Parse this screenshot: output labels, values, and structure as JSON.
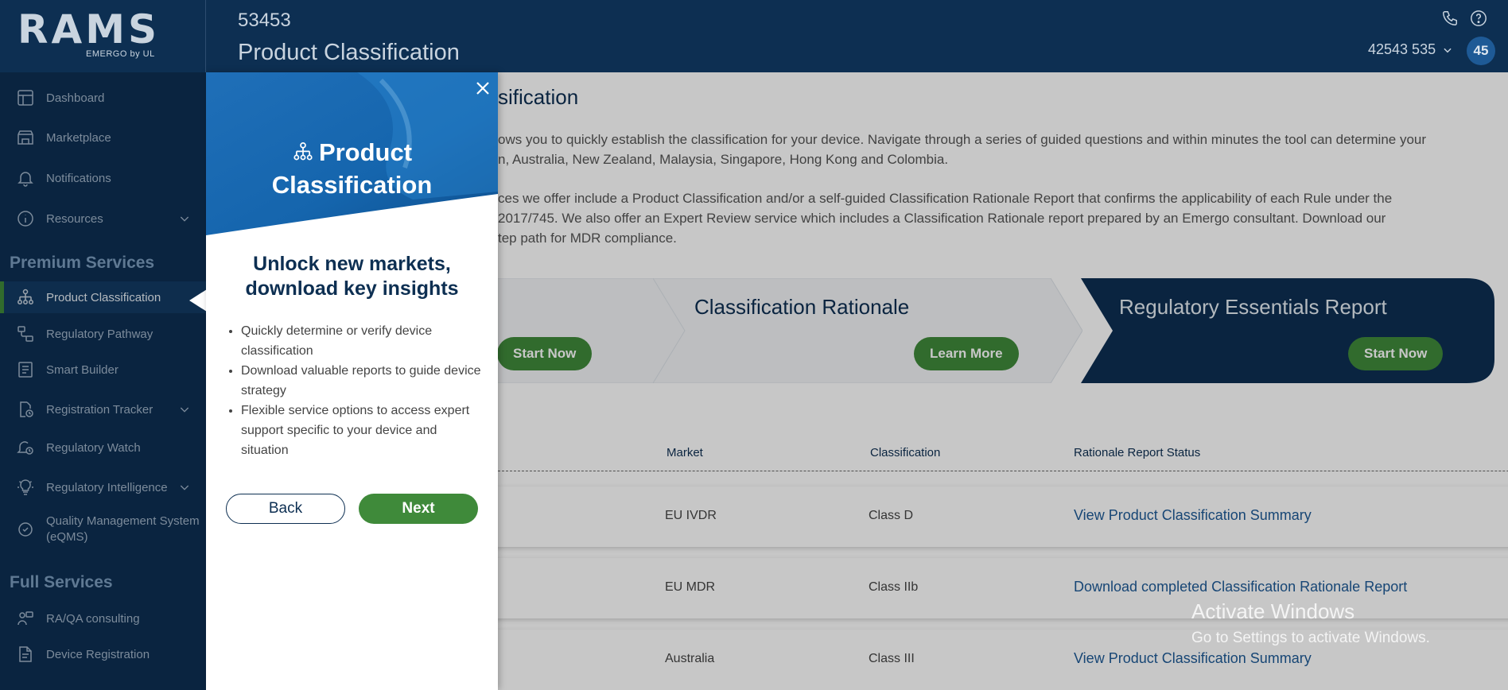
{
  "header": {
    "logo_text": "RAMS",
    "logo_sub": "EMERGO by UL",
    "record_id": "53453",
    "page_title": "Product Classification",
    "account_label": "42543 535",
    "avatar_text": "45"
  },
  "sidebar": {
    "top_items": [
      {
        "label": "Dashboard",
        "icon": "dashboard-icon"
      },
      {
        "label": "Marketplace",
        "icon": "store-icon"
      },
      {
        "label": "Notifications",
        "icon": "bell-icon"
      },
      {
        "label": "Resources",
        "icon": "info-icon"
      }
    ],
    "premium_heading": "Premium Services",
    "premium_items": [
      {
        "label": "Product Classification",
        "icon": "hierarchy-icon",
        "active": true
      },
      {
        "label": "Regulatory Pathway",
        "icon": "pathway-icon"
      },
      {
        "label": "Smart Builder",
        "icon": "document-icon"
      },
      {
        "label": "Registration Tracker",
        "icon": "tracker-icon"
      },
      {
        "label": "Regulatory Watch",
        "icon": "bell-clock-icon"
      },
      {
        "label": "Regulatory Intelligence",
        "icon": "lightbulb-icon"
      },
      {
        "label": "Quality Management System (eQMS)",
        "icon": "qms-icon"
      }
    ],
    "full_heading": "Full Services",
    "full_items": [
      {
        "label": "RA/QA consulting",
        "icon": "consulting-icon"
      },
      {
        "label": "Device Registration",
        "icon": "registration-icon"
      }
    ]
  },
  "main": {
    "title_partial": "sification",
    "para1_line1": "ows you to quickly establish the classification for your device. Navigate through a series of guided questions and within minutes the tool can determine your",
    "para1_line2": "n, Australia, New Zealand, Malaysia, Singapore, Hong Kong and Colombia.",
    "para2_line1": "ces we offer include a Product Classification and/or a self-guided Classification Rationale Report that confirms the applicability of each Rule under the",
    "para2_line2": "2017/745. We also offer an Expert Review service which includes a Classification Rationale report prepared by an Emergo consultant. Download our",
    "para2_line3": "tep path for MDR compliance.",
    "cards": [
      {
        "title": "",
        "button": "Start Now"
      },
      {
        "title": "Classification Rationale",
        "button": "Learn More"
      },
      {
        "title": "Regulatory Essentials Report",
        "button": "Start Now"
      }
    ],
    "columns": [
      "Market",
      "Classification",
      "Rationale Report Status"
    ],
    "rows": [
      {
        "market": "EU IVDR",
        "classification": "Class D",
        "status": "View Product Classification Summary"
      },
      {
        "market": "EU MDR",
        "classification": "Class IIb",
        "status": "Download completed Classification Rationale Report"
      },
      {
        "market": "Australia",
        "classification": "Class III",
        "status": "View Product Classification Summary"
      }
    ]
  },
  "watermark": {
    "line1": "Activate Windows",
    "line2": "Go to Settings to activate Windows."
  },
  "modal": {
    "hero_title_line1": "Product",
    "hero_title_line2": "Classification",
    "heading_line1": "Unlock new markets,",
    "heading_line2": "download key insights",
    "bullets": [
      "Quickly determine or verify device classification",
      "Download valuable reports to guide device strategy",
      "Flexible service options to access expert support specific to your device and situation"
    ],
    "back_label": "Back",
    "next_label": "Next"
  },
  "colors": {
    "navy": "#0d2f52",
    "green": "#3f8a3a",
    "link_blue": "#1e5a96"
  }
}
